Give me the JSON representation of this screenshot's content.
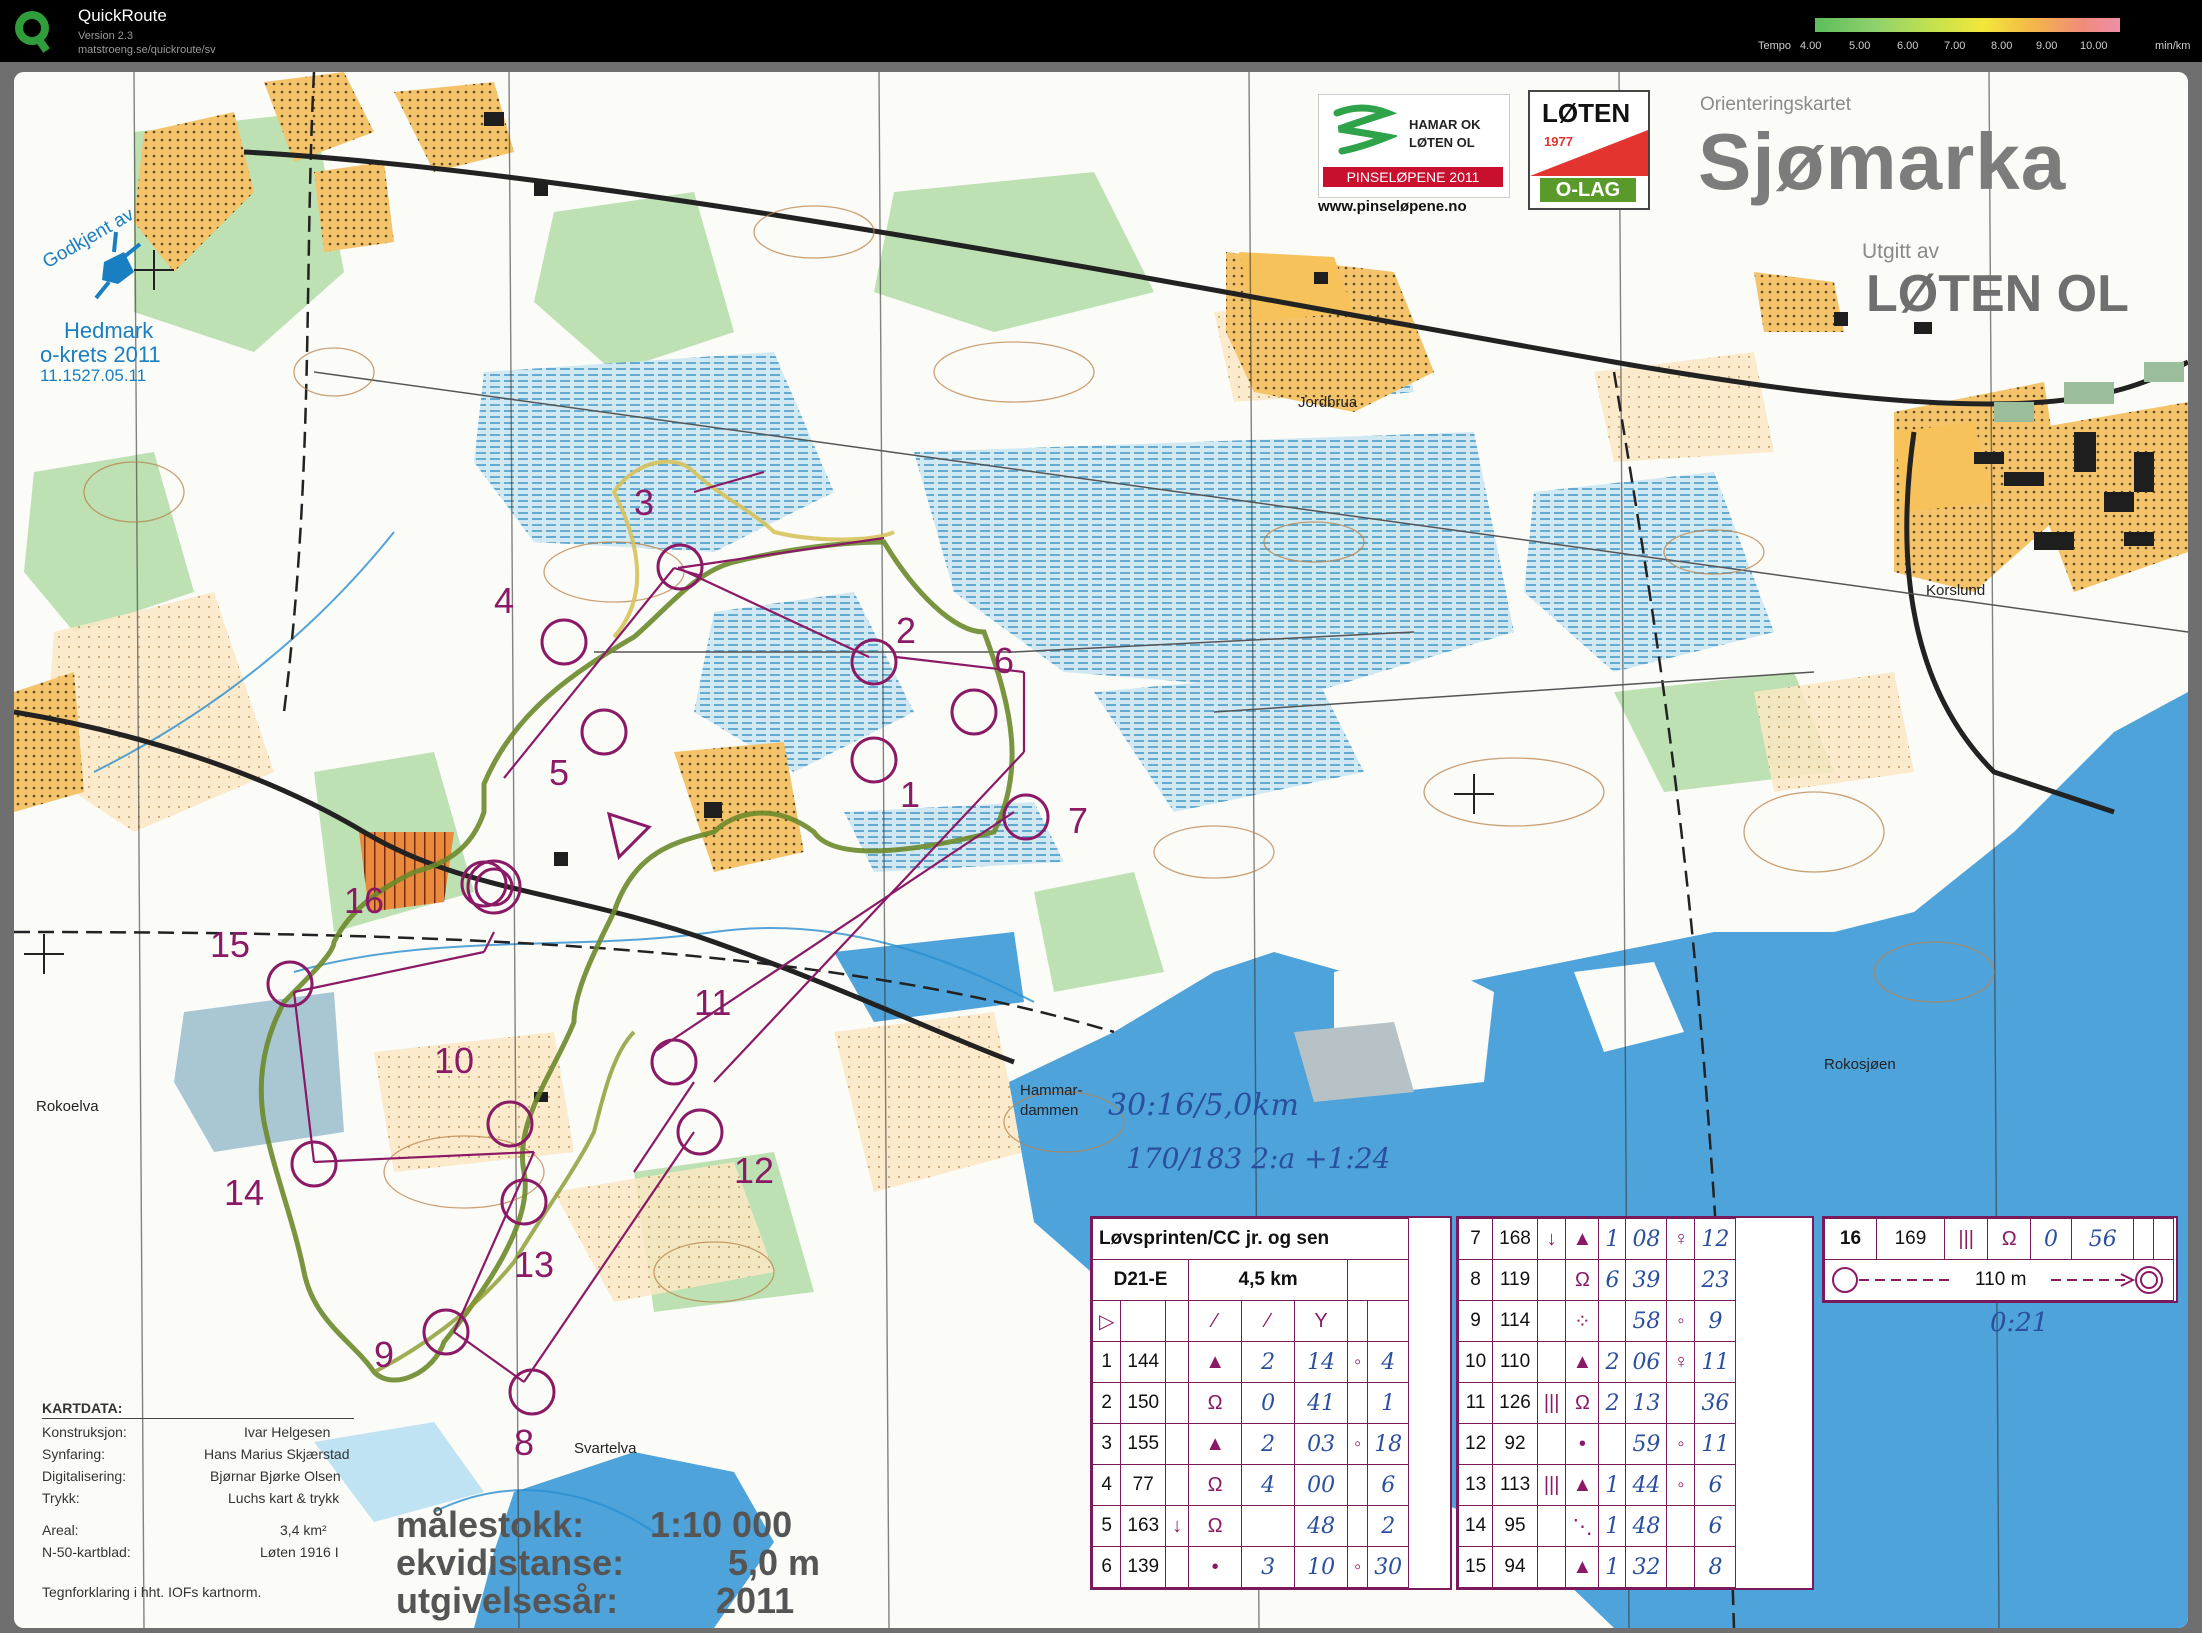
{
  "app": {
    "name": "QuickRoute",
    "version": "Version 2.3",
    "url": "matstroeng.se/quickroute/sv",
    "tempo_label": "Tempo",
    "tempo_ticks": [
      "4.00",
      "5.00",
      "6.00",
      "7.00",
      "8.00",
      "9.00",
      "10.00"
    ],
    "tempo_unit": "min/km"
  },
  "map": {
    "series_label": "Orienteringskartet",
    "title": "Sjømarka",
    "published_by": "Utgitt av",
    "publisher": "LØTEN OL",
    "sponsor1_line1": "HAMAR OK",
    "sponsor1_line2": "LØTEN OL",
    "sponsor1_event": "PINSELØPENE 2011",
    "sponsor1_url": "www.pinseløpene.no",
    "sponsor2_top": "LØTEN",
    "sponsor2_year": "1977",
    "sponsor2_bottom": "O-LAG",
    "approval_1": "Godkjent av",
    "approval_2": "Hedmark",
    "approval_3": "o-krets 2011",
    "approval_4": "11.1527.05.11",
    "places": [
      "Jordbrua",
      "Korslund",
      "Rokoelva",
      "Hammar-",
      "dammen",
      "Rokosjøen",
      "Svartelva"
    ],
    "credits": {
      "header": "KARTDATA:",
      "rows": [
        [
          "Konstruksjon:",
          "Ivar Helgesen"
        ],
        [
          "Synfaring:",
          "Hans Marius Skjærstad"
        ],
        [
          "Digitalisering:",
          "Bjørnar Bjørke Olsen"
        ],
        [
          "Trykk:",
          "Luchs kart & trykk"
        ],
        [
          "Areal:",
          "3,4 km²"
        ],
        [
          "N-50-kartblad:",
          "Løten 1916 I"
        ]
      ],
      "footer": "Tegnforklaring i hht. IOFs kartnorm."
    },
    "scale": {
      "label1": "målestokk:",
      "value1": "1:10 000",
      "label2": "ekvidistanse:",
      "value2": "5,0 m",
      "label3": "utgivelsesår:",
      "value3": "2011"
    },
    "handwritten": {
      "line1": "30:16/5,0km",
      "line2": "170/183   2:a   +1:24",
      "finish_time": "0:21"
    },
    "controls": [
      "1",
      "2",
      "3",
      "4",
      "5",
      "6",
      "7",
      "8",
      "9",
      "10",
      "11",
      "12",
      "13",
      "14",
      "15",
      "16"
    ]
  },
  "course": {
    "title": "Løvsprinten/CC jr. og sen",
    "class": "D21-E",
    "length": "4,5 km",
    "left_rows": [
      {
        "n": "1",
        "code": "144",
        "c": "",
        "d": "▲",
        "e": "2",
        "time": "14",
        "g": "◦",
        "h": "4"
      },
      {
        "n": "2",
        "code": "150",
        "c": "",
        "d": "Ω",
        "e": "0",
        "time": "41",
        "g": "",
        "h": "1"
      },
      {
        "n": "3",
        "code": "155",
        "c": "",
        "d": "▲",
        "e": "2",
        "time": "03",
        "g": "◦",
        "h": "18"
      },
      {
        "n": "4",
        "code": "77",
        "c": "",
        "d": "Ω",
        "e": "4",
        "time": "00",
        "g": "",
        "h": "6"
      },
      {
        "n": "5",
        "code": "163",
        "c": "↓",
        "d": "Ω",
        "e": "",
        "time": "48",
        "g": "",
        "h": "2"
      },
      {
        "n": "6",
        "code": "139",
        "c": "",
        "d": "•",
        "e": "3",
        "time": "10",
        "g": "◦",
        "h": "30"
      }
    ],
    "mid_rows": [
      {
        "n": "7",
        "code": "168",
        "c": "↓",
        "d": "▲",
        "e": "1",
        "time": "08",
        "g": "♀",
        "h": "12"
      },
      {
        "n": "8",
        "code": "119",
        "c": "",
        "d": "Ω",
        "e": "6",
        "time": "39",
        "g": "",
        "h": "23"
      },
      {
        "n": "9",
        "code": "114",
        "c": "",
        "d": "⁘",
        "e": "",
        "time": "58",
        "g": "◦",
        "h": "9"
      },
      {
        "n": "10",
        "code": "110",
        "c": "",
        "d": "▲",
        "e": "2",
        "time": "06",
        "g": "♀",
        "h": "11"
      },
      {
        "n": "11",
        "code": "126",
        "c": "|||",
        "d": "Ω",
        "e": "2",
        "time": "13",
        "g": "",
        "h": "36"
      },
      {
        "n": "12",
        "code": "92",
        "c": "",
        "d": "•",
        "e": "",
        "time": "59",
        "g": "◦",
        "h": "11"
      },
      {
        "n": "13",
        "code": "113",
        "c": "|||",
        "d": "▲",
        "e": "1",
        "time": "44",
        "g": "◦",
        "h": "6"
      },
      {
        "n": "14",
        "code": "95",
        "c": "",
        "d": "⋱",
        "e": "1",
        "time": "48",
        "g": "",
        "h": "6"
      },
      {
        "n": "15",
        "code": "94",
        "c": "",
        "d": "▲",
        "e": "1",
        "time": "32",
        "g": "",
        "h": "8"
      }
    ],
    "last_row": {
      "n": "16",
      "code": "169",
      "c": "|||",
      "d": "Ω",
      "e": "0",
      "time": "56"
    },
    "finish_distance": "110 m"
  },
  "colors": {
    "overprint": "#8b1a66",
    "route": "#6b8a2a",
    "open_land": "#f4b84a",
    "marsh": "#4aa0c8",
    "water": "#4ea3db",
    "green": "#8ccc7a",
    "ink": "#2a4f9e"
  }
}
